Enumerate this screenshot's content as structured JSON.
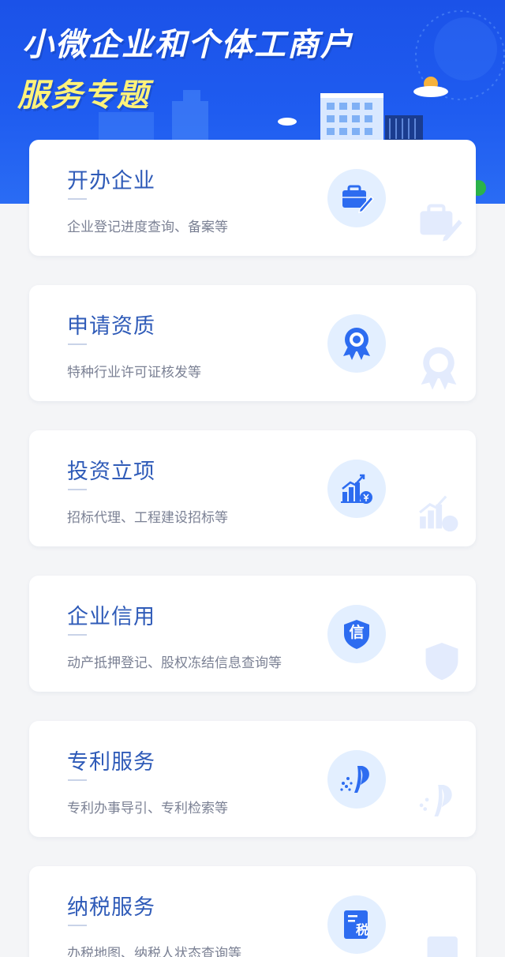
{
  "banner": {
    "title_line1": "小微企业和个体工商户",
    "title_line2": "服务专题"
  },
  "services": [
    {
      "title": "开办企业",
      "desc": "企业登记进度查询、备案等",
      "icon": "briefcase-pen-icon"
    },
    {
      "title": "申请资质",
      "desc": "特种行业许可证核发等",
      "icon": "award-ribbon-icon"
    },
    {
      "title": "投资立项",
      "desc": "招标代理、工程建设招标等",
      "icon": "bar-chart-yen-icon"
    },
    {
      "title": "企业信用",
      "desc": "动产抵押登记、股权冻结信息查询等",
      "icon": "credit-shield-icon",
      "icon_text": "信"
    },
    {
      "title": "专利服务",
      "desc": "专利办事导引、专利检索等",
      "icon": "patent-logo-icon"
    },
    {
      "title": "纳税服务",
      "desc": "办税地图、纳税人状态查询等",
      "icon": "tax-document-icon",
      "icon_text": "税"
    }
  ],
  "colors": {
    "banner_blue": "#1f5cf0",
    "title_yellow": "#fff27a",
    "card_title": "#2f5bb8",
    "icon_blue": "#2d6cf0",
    "icon_bg": "#e3efff",
    "page_bg": "#f4f5f7"
  }
}
